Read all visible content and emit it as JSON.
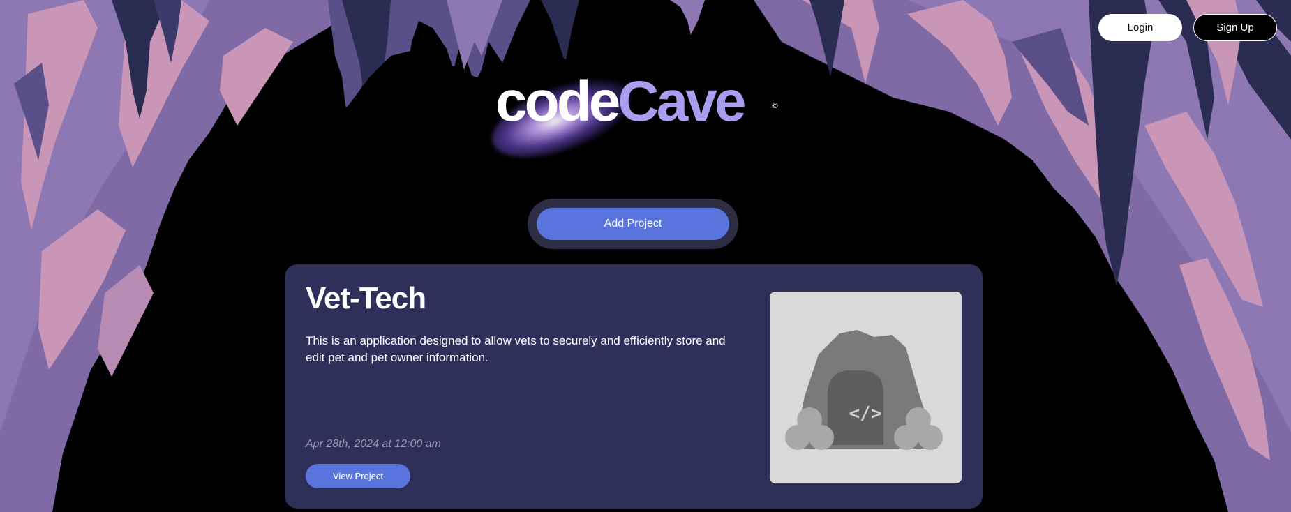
{
  "auth": {
    "login_label": "Login",
    "signup_label": "Sign Up"
  },
  "logo": {
    "code_text": "code",
    "cave_text": "Cave",
    "mark": "©"
  },
  "actions": {
    "add_project_label": "Add Project"
  },
  "project": {
    "title": "Vet-Tech",
    "description": "This is an application designed to allow vets to securely and efficiently store and edit pet and pet owner information.",
    "date": "Apr 28th, 2024 at 12:00 am",
    "view_label": "View Project",
    "thumbnail_icon": "cave-code-icon"
  },
  "colors": {
    "accent": "#5a74dd",
    "card_bg": "#2f305a",
    "logo_cave": "#a79ef0"
  }
}
